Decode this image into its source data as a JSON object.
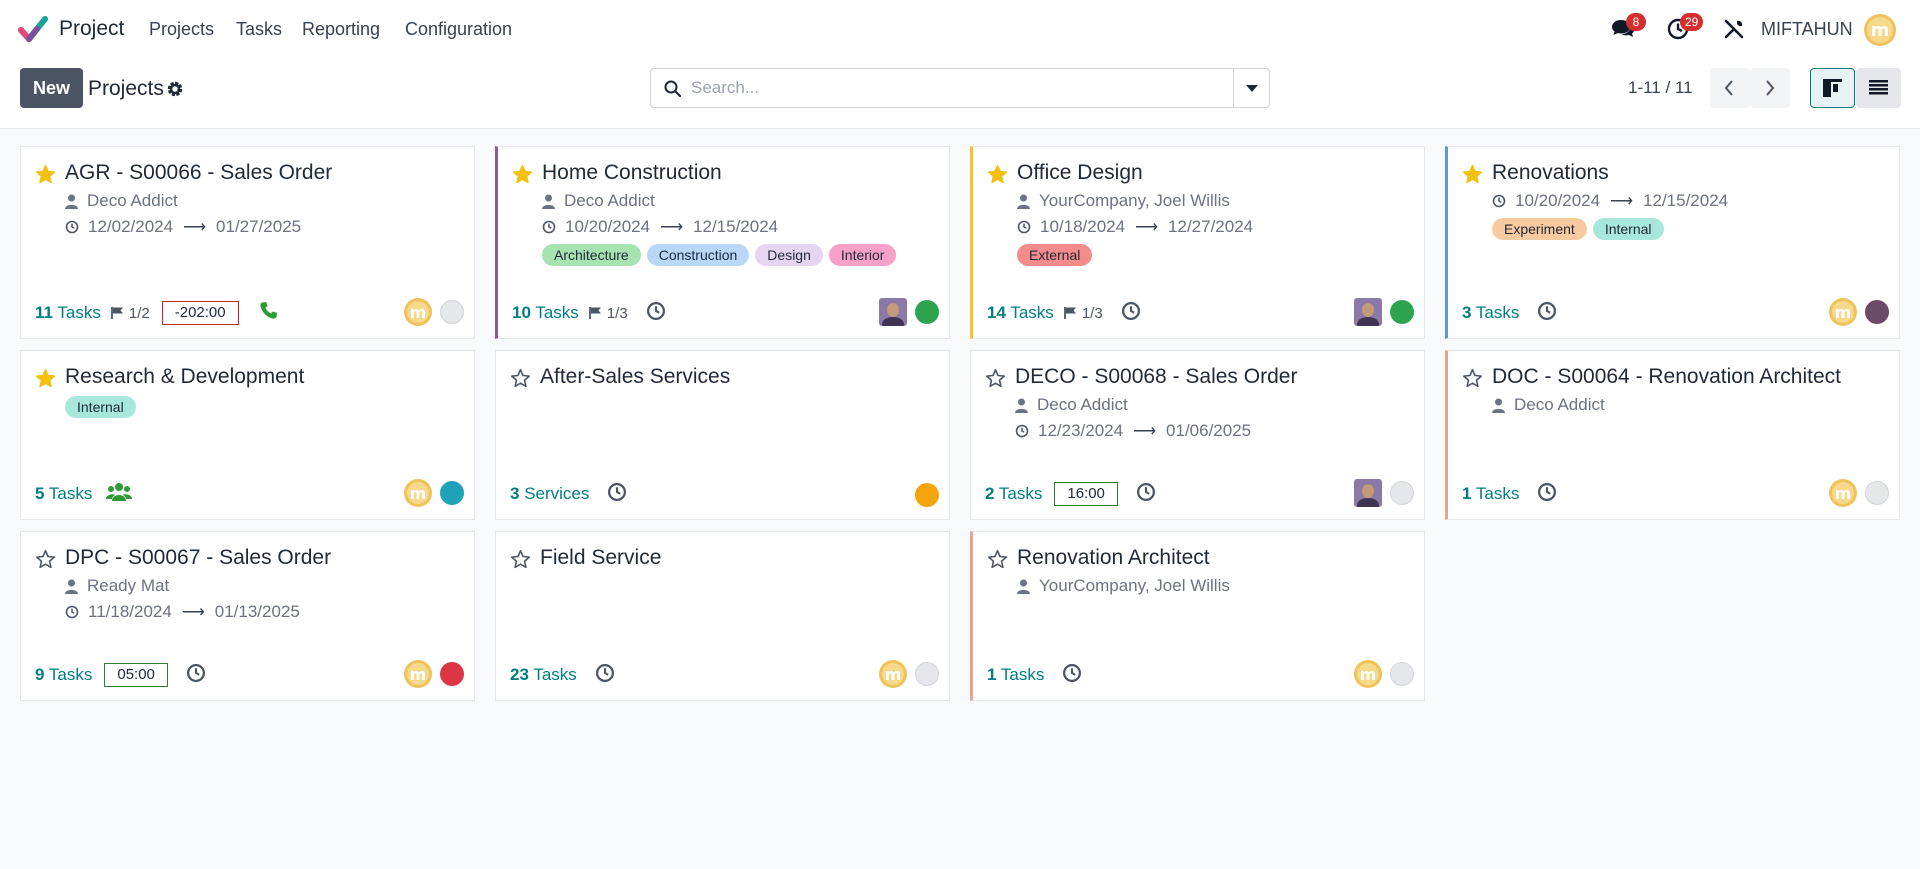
{
  "app": {
    "name": "Project"
  },
  "nav": {
    "items": [
      "Projects",
      "Tasks",
      "Reporting",
      "Configuration"
    ]
  },
  "systray": {
    "messages_count": "8",
    "activities_count": "29",
    "user_name": "MIFTAHUN",
    "user_initial": "m"
  },
  "control": {
    "new_label": "New",
    "title": "Projects",
    "search_placeholder": "Search...",
    "pager": "1-11 / 11"
  },
  "colors": {
    "accent": "#017e84",
    "primary_button": "#4b5563",
    "badge": "#d32f2f",
    "star": "#f3c00f"
  },
  "cards": [
    {
      "title": "AGR - S00066 - Sales Order",
      "starred": true,
      "customer": "Deco Addict",
      "date_start": "12/02/2024",
      "date_end": "01/27/2025",
      "tags": [],
      "tasks_count": "11",
      "tasks_label": "Tasks",
      "milestones": "1/2",
      "timesheet": "-202:00",
      "icon": "phone-icon",
      "status": "grey"
    },
    {
      "title": "Home Construction",
      "starred": true,
      "customer": "Deco Addict",
      "date_start": "10/20/2024",
      "date_end": "12/15/2024",
      "tags": [
        {
          "label": "Architecture",
          "color": "#a6e3b0"
        },
        {
          "label": "Construction",
          "color": "#b9d7f7"
        },
        {
          "label": "Design",
          "color": "#e5d5f3"
        },
        {
          "label": "Interior",
          "color": "#f7a1c8"
        }
      ],
      "tasks_count": "10",
      "tasks_label": "Tasks",
      "milestones": "1/3",
      "icon": "clock-icon",
      "bar_color": "#8b5a93",
      "status": "green"
    },
    {
      "title": "Office Design",
      "starred": true,
      "customer": "YourCompany, Joel Willis",
      "date_start": "10/18/2024",
      "date_end": "12/27/2024",
      "tags": [
        {
          "label": "External",
          "color": "#f58c8c"
        }
      ],
      "tasks_count": "14",
      "tasks_label": "Tasks",
      "milestones": "1/3",
      "icon": "clock-icon",
      "bar_color": "#f0c42f",
      "status": "green"
    },
    {
      "title": "Renovations",
      "starred": true,
      "date_start": "10/20/2024",
      "date_end": "12/15/2024",
      "tags": [
        {
          "label": "Experiment",
          "color": "#f9c9a0"
        },
        {
          "label": "Internal",
          "color": "#a7e7dc"
        }
      ],
      "tasks_count": "3",
      "tasks_label": "Tasks",
      "icon": "clock-icon",
      "bar_color": "#5b9bd5",
      "status": "plum"
    },
    {
      "title": "Research & Development",
      "starred": true,
      "tags": [
        {
          "label": "Internal",
          "color": "#a7e7dc"
        }
      ],
      "tasks_count": "5",
      "tasks_label": "Tasks",
      "icon": "users-icon",
      "status": "teal"
    },
    {
      "title": "After-Sales Services",
      "starred": false,
      "tags": [],
      "tasks_count": "3",
      "tasks_label": "Services",
      "icon": "clock-icon",
      "status": "orange"
    },
    {
      "title": "DECO - S00068 - Sales Order",
      "starred": false,
      "customer": "Deco Addict",
      "date_start": "12/23/2024",
      "date_end": "01/06/2025",
      "tags": [],
      "tasks_count": "2",
      "tasks_label": "Tasks",
      "timesheet": "16:00",
      "icon": "clock-icon",
      "status": "grey"
    },
    {
      "title": "DOC - S00064 - Renovation Architect",
      "starred": false,
      "customer": "Deco Addict",
      "tags": [],
      "tasks_count": "1",
      "tasks_label": "Tasks",
      "icon": "clock-icon",
      "bar_color": "#e8a48c",
      "status": "grey"
    },
    {
      "title": "DPC - S00067 - Sales Order",
      "starred": false,
      "customer": "Ready Mat",
      "date_start": "11/18/2024",
      "date_end": "01/13/2025",
      "tags": [],
      "tasks_count": "9",
      "tasks_label": "Tasks",
      "timesheet": "05:00",
      "icon": "clock-icon",
      "status": "red"
    },
    {
      "title": "Field Service",
      "starred": false,
      "tags": [],
      "tasks_count": "23",
      "tasks_label": "Tasks",
      "icon": "clock-icon",
      "status": "grey"
    },
    {
      "title": "Renovation Architect",
      "starred": false,
      "customer": "YourCompany, Joel Willis",
      "tags": [],
      "tasks_count": "1",
      "tasks_label": "Tasks",
      "icon": "clock-icon",
      "bar_color": "#e8a48c",
      "status": "grey"
    }
  ]
}
